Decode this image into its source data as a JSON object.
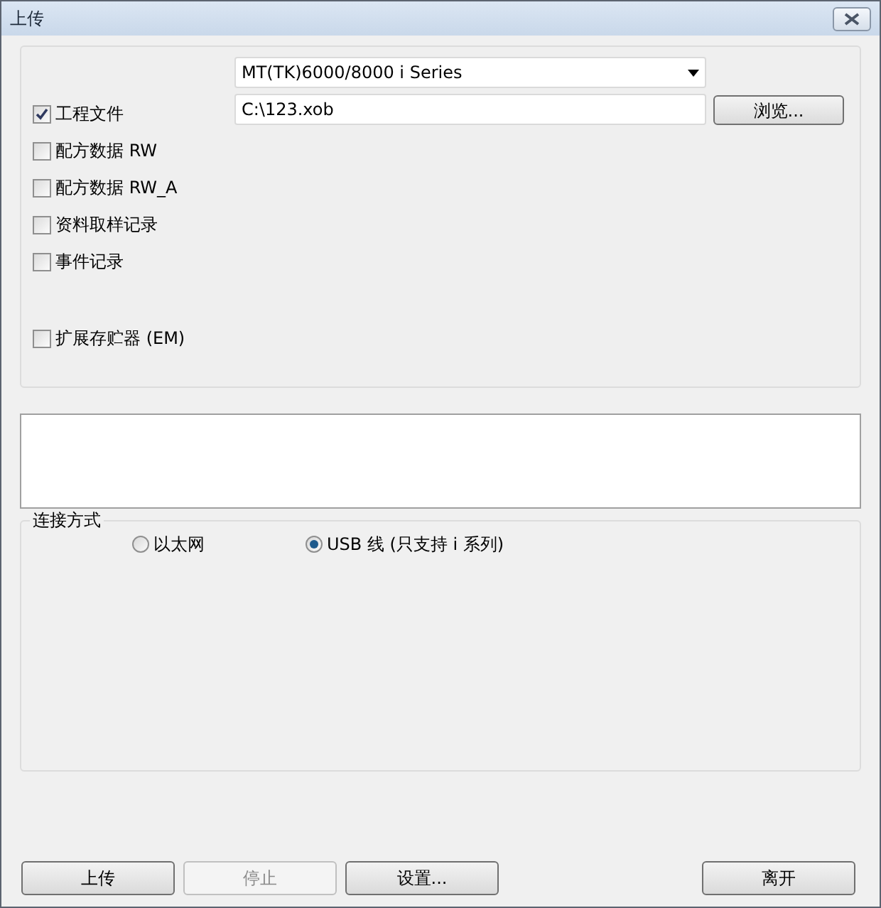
{
  "window": {
    "title": "上传"
  },
  "device_select": {
    "value": "MT(TK)6000/8000 i Series"
  },
  "file_path": {
    "value": "C:\\123.xob"
  },
  "browse_button": {
    "label": "浏览..."
  },
  "options": [
    {
      "label": "工程文件",
      "checked": true
    },
    {
      "label": "配方数据 RW",
      "checked": false
    },
    {
      "label": "配方数据 RW_A",
      "checked": false
    },
    {
      "label": "资料取样记录",
      "checked": false
    },
    {
      "label": "事件记录",
      "checked": false
    },
    {
      "label": "扩展存贮器 (EM)",
      "checked": false
    }
  ],
  "connection": {
    "label": "连接方式",
    "options": [
      {
        "label": "以太网",
        "selected": false
      },
      {
        "label": "USB 线 (只支持 i 系列)",
        "selected": true
      }
    ]
  },
  "buttons": [
    {
      "label": "上传",
      "disabled": false
    },
    {
      "label": "停止",
      "disabled": true
    },
    {
      "label": "设置...",
      "disabled": false
    },
    {
      "label": "离开",
      "disabled": false
    }
  ]
}
